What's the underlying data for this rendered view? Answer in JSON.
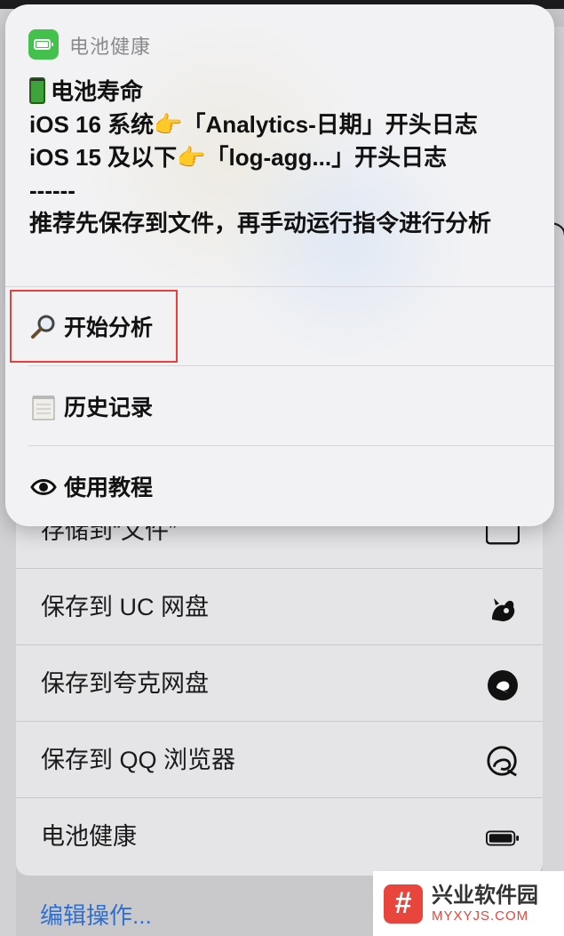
{
  "notification": {
    "app_name": "电池健康",
    "app_icon": "battery-icon",
    "lines": [
      "电池寿命",
      "iOS 16 系统👉「Analytics-日期」开头日志",
      "iOS 15 及以下👉「log-agg...」开头日志",
      "------",
      "推荐先保存到文件，再手动运行指令进行分析"
    ],
    "menu": [
      {
        "label": "开始分析",
        "icon": "magnifier-icon"
      },
      {
        "label": "历史记录",
        "icon": "notepad-icon"
      },
      {
        "label": "使用教程",
        "icon": "eye-icon"
      }
    ]
  },
  "share_sheet": {
    "actions": [
      {
        "label": "存储到“文件”",
        "icon": "folder-icon"
      },
      {
        "label": "保存到 UC 网盘",
        "icon": "uc-squirrel-icon"
      },
      {
        "label": "保存到夸克网盘",
        "icon": "quark-icon"
      },
      {
        "label": "保存到 QQ 浏览器",
        "icon": "qq-browser-icon"
      },
      {
        "label": "电池健康",
        "icon": "battery-icon"
      }
    ],
    "edit_label": "编辑操作..."
  },
  "watermark": {
    "title": "兴业软件园",
    "subtitle": "MYXYJS.COM"
  },
  "colors": {
    "highlight": "#e8403c",
    "link": "#2f6fd1",
    "app_icon": "#43c14c"
  }
}
